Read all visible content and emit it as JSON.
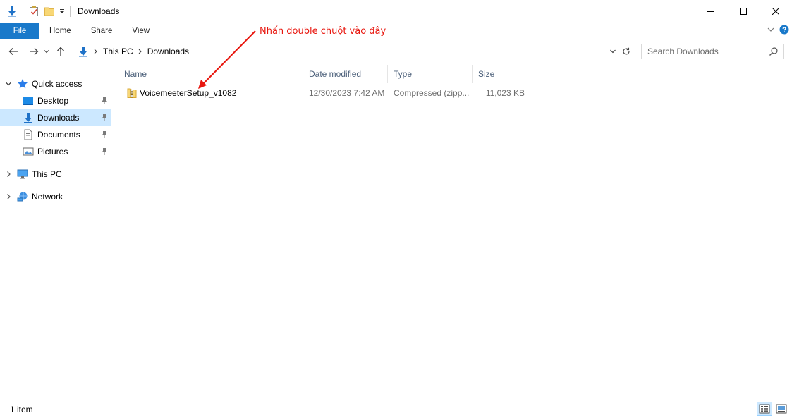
{
  "window": {
    "title": "Downloads"
  },
  "ribbon": {
    "tabs": [
      "File",
      "Home",
      "Share",
      "View"
    ]
  },
  "address": {
    "crumbs": [
      "This PC",
      "Downloads"
    ]
  },
  "search": {
    "placeholder": "Search Downloads"
  },
  "navpane": {
    "quick_access": "Quick access",
    "items": [
      {
        "label": "Desktop",
        "icon": "desktop-icon",
        "pinned": true
      },
      {
        "label": "Downloads",
        "icon": "downloads-icon",
        "pinned": true,
        "selected": true
      },
      {
        "label": "Documents",
        "icon": "documents-icon",
        "pinned": true
      },
      {
        "label": "Pictures",
        "icon": "pictures-icon",
        "pinned": true
      }
    ],
    "this_pc": "This PC",
    "network": "Network"
  },
  "columns": [
    "Name",
    "Date modified",
    "Type",
    "Size"
  ],
  "files": [
    {
      "name": "VoicemeeterSetup_v1082",
      "date": "12/30/2023 7:42 AM",
      "type": "Compressed (zipp...",
      "size": "11,023 KB",
      "icon": "zip-folder-icon"
    }
  ],
  "annotation": {
    "text": "Nhấn double chuột vào đây",
    "color": "#e8170f"
  },
  "status": {
    "count": "1 item"
  },
  "colors": {
    "file_tab": "#1979ca",
    "selected": "#cce8ff",
    "header_text": "#4c607a"
  }
}
